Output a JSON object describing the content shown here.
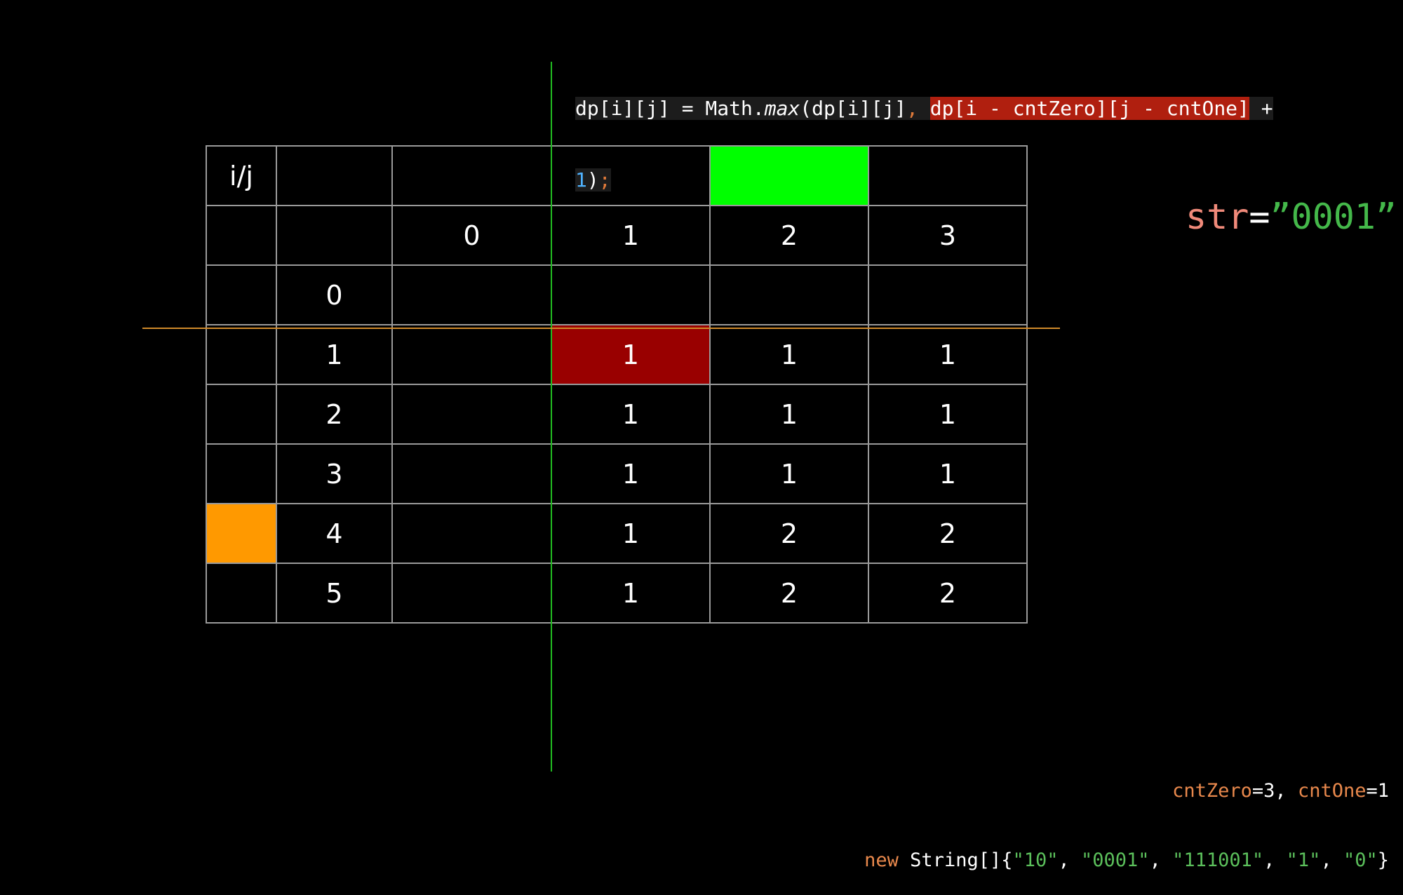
{
  "code": {
    "line1_a": "dp[i][j] = Math.",
    "line1_fn": "max",
    "line1_b": "(dp[i][j]",
    "line1_comma": ",",
    "line1_sp": " ",
    "line1_hl": "dp[i - cntZero][j - cntOne]",
    "line1_plus": " +",
    "line2_num": "1",
    "line2_paren": ")",
    "line2_semi": ";"
  },
  "table": {
    "corner_label": "i/j",
    "col_headers": [
      "0",
      "1",
      "2",
      "3"
    ],
    "rows": [
      {
        "label": "0",
        "cells": [
          "",
          "",
          "",
          ""
        ]
      },
      {
        "label": "1",
        "cells": [
          "",
          "1",
          "1",
          "1"
        ]
      },
      {
        "label": "2",
        "cells": [
          "",
          "1",
          "1",
          "1"
        ]
      },
      {
        "label": "3",
        "cells": [
          "",
          "1",
          "1",
          "1"
        ]
      },
      {
        "label": "4",
        "cells": [
          "",
          "1",
          "2",
          "2"
        ]
      },
      {
        "label": "5",
        "cells": [
          "",
          "1",
          "2",
          "2"
        ]
      }
    ]
  },
  "colors": {
    "highlight_green": "#00ff00",
    "highlight_red": "#990000",
    "highlight_orange": "#ff9900",
    "yellow_value": "#ffff33"
  },
  "str_label": {
    "key": "str",
    "eq": "=",
    "value": "”0001”"
  },
  "counts": {
    "zero_key": "cntZero",
    "zero_eq": "=3, ",
    "one_key": "cntOne",
    "one_eq": "=1"
  },
  "strings_line": {
    "kw_new": "new",
    "type": " String[]{",
    "items": [
      "\"10\"",
      "\"0001\"",
      "\"111001\"",
      "\"1\"",
      "\"0\""
    ],
    "sep": ", ",
    "close": "}"
  }
}
